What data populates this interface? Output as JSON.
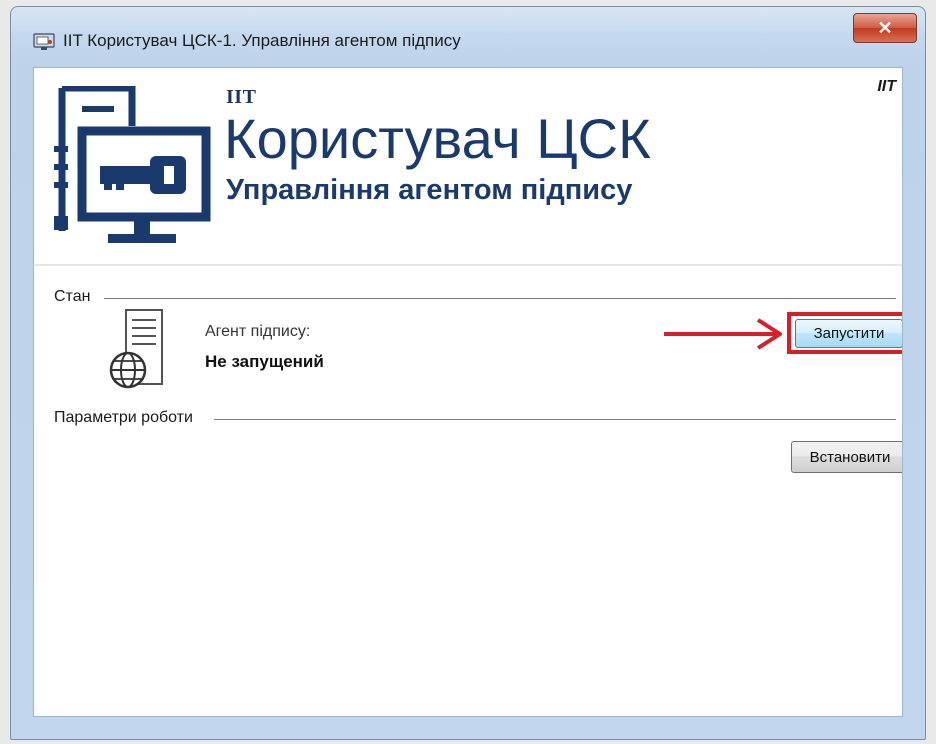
{
  "window": {
    "title": "IIT Користувач ЦСК-1. Управління агентом підпису",
    "close_symbol": "✕",
    "app_icon": "computer-icon"
  },
  "banner": {
    "brand_small": "IIT",
    "title": "Користувач ЦСК",
    "subtitle": "Управління агентом підпису",
    "corner_mark": "IIT",
    "logo_icon": "monitor-key-icon"
  },
  "status_group": {
    "label": "Стан",
    "icon": "server-globe-icon",
    "agent_label": "Агент підпису:",
    "agent_status": "Не запущений",
    "start_button": "Запустити"
  },
  "params_group": {
    "label": "Параметри роботи",
    "install_button": "Встановити"
  },
  "annotation": {
    "arrow_color": "#d3202a",
    "highlight_color": "#d3202a"
  }
}
